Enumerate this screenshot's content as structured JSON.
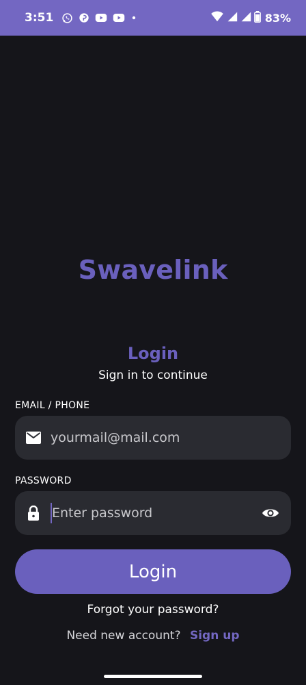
{
  "status_bar": {
    "time": "3:51",
    "left_icons": [
      "whatsapp-icon",
      "pinterest-icon",
      "youtube-icon",
      "youtube-icon",
      "dot-icon"
    ],
    "right_icons": [
      "wifi-icon",
      "signal-icon",
      "signal-icon",
      "battery-icon"
    ],
    "battery_percent": "83%"
  },
  "brand": {
    "name": "Swavelink"
  },
  "login": {
    "heading": "Login",
    "subheading": "Sign in to continue"
  },
  "email_field": {
    "label": "EMAIL / PHONE",
    "placeholder": "yourmail@mail.com",
    "value": "",
    "icon": "mail-icon"
  },
  "password_field": {
    "label": "PASSWORD",
    "placeholder": "Enter password",
    "value": "",
    "icon": "lock-icon",
    "toggle_icon": "eye-icon"
  },
  "actions": {
    "login_label": "Login",
    "forgot_label": "Forgot your password?",
    "need_account_label": "Need new account?",
    "signup_label": "Sign up"
  },
  "colors": {
    "accent": "#6a60bd",
    "status_bar": "#7367c2",
    "background": "#15151a",
    "field_bg": "#2a2b31"
  }
}
